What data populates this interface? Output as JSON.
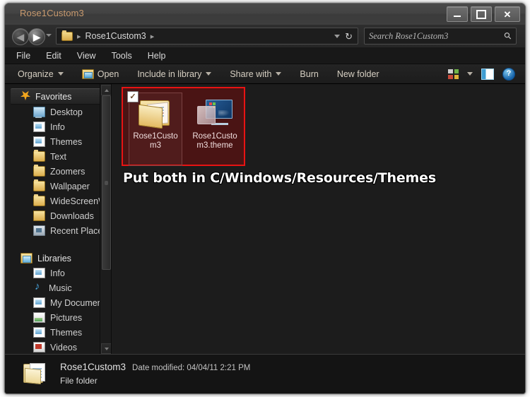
{
  "window": {
    "title": "Rose1Custom3",
    "controls": {
      "minimize": "minimize-button",
      "maximize": "maximize-button",
      "close": "✕"
    }
  },
  "address": {
    "back_arrow": "◀",
    "forward_arrow": "▶",
    "crumb_separator": "▸",
    "path_text": "Rose1Custom3",
    "refresh_glyph": "↻"
  },
  "search": {
    "placeholder": "Search Rose1Custom3",
    "icon": "⚲"
  },
  "menubar": {
    "items": [
      "File",
      "Edit",
      "View",
      "Tools",
      "Help"
    ]
  },
  "toolbar": {
    "organize": "Organize",
    "open": "Open",
    "include_in_library": "Include in library",
    "share_with": "Share with",
    "burn": "Burn",
    "new_folder": "New folder",
    "help_glyph": "?"
  },
  "sidebar": {
    "favorites": {
      "label": "Favorites",
      "items": [
        {
          "label": "Desktop",
          "icon": "desktop-icon"
        },
        {
          "label": "Info",
          "icon": "document-icon"
        },
        {
          "label": "Themes",
          "icon": "document-icon"
        },
        {
          "label": "Text",
          "icon": "folder-icon"
        },
        {
          "label": "Zoomers",
          "icon": "folder-icon"
        },
        {
          "label": "Wallpaper",
          "icon": "folder-icon"
        },
        {
          "label": "WideScreenWal",
          "icon": "folder-icon"
        },
        {
          "label": "Downloads",
          "icon": "downloads-icon"
        },
        {
          "label": "Recent Places",
          "icon": "recent-places-icon"
        }
      ]
    },
    "libraries": {
      "label": "Libraries",
      "items": [
        {
          "label": "Info",
          "icon": "document-icon"
        },
        {
          "label": "Music",
          "icon": "music-note-icon"
        },
        {
          "label": "My Documents",
          "icon": "document-icon"
        },
        {
          "label": "Pictures",
          "icon": "picture-icon"
        },
        {
          "label": "Themes",
          "icon": "document-icon"
        },
        {
          "label": "Videos",
          "icon": "video-icon"
        }
      ]
    }
  },
  "content": {
    "files": [
      {
        "name": "Rose1Custom3",
        "icon": "open-folder-icon",
        "selected": true,
        "checked": true
      },
      {
        "name": "Rose1Custom3.theme",
        "icon": "theme-file-icon",
        "selected": true,
        "checked": false
      }
    ],
    "checkmark": "✓",
    "banner": "Put both in C/Windows/Resources/Themes",
    "selection_fill": "#4a1414",
    "selection_border": "#e81313"
  },
  "statusbar": {
    "name": "Rose1Custom3",
    "meta": "Date modified: 04/04/11 2:21 PM",
    "type": "File folder"
  }
}
